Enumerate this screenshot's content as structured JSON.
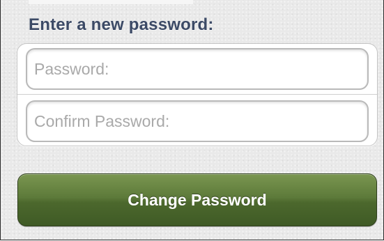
{
  "form": {
    "heading": "Enter a new password:",
    "password_field": {
      "placeholder": "Password:",
      "value": ""
    },
    "confirm_field": {
      "placeholder": "Confirm Password:",
      "value": ""
    },
    "submit_label": "Change Password"
  },
  "colors": {
    "heading_text": "#3c4a66",
    "button_green": "#5d7a3a",
    "background": "#e9e9e9"
  }
}
